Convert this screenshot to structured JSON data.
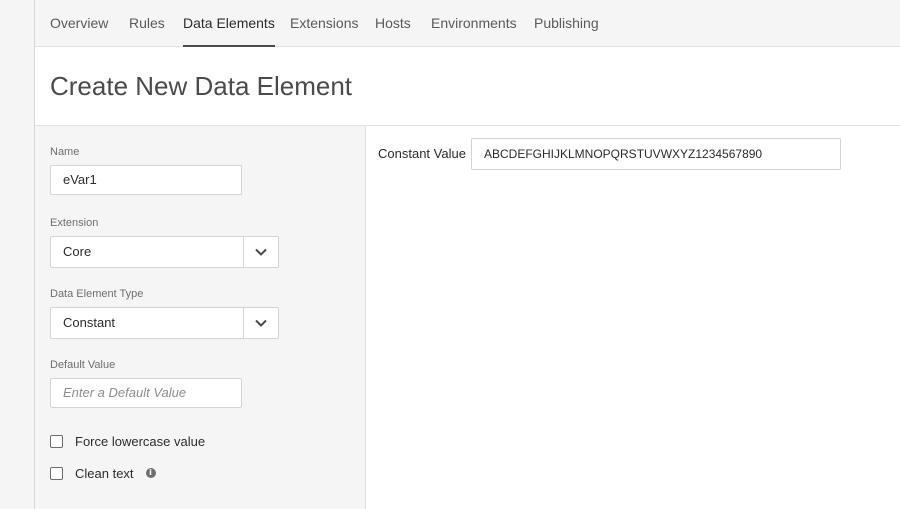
{
  "nav": {
    "tabs": [
      {
        "label": "Overview"
      },
      {
        "label": "Rules"
      },
      {
        "label": "Data Elements",
        "active": true
      },
      {
        "label": "Extensions"
      },
      {
        "label": "Hosts"
      },
      {
        "label": "Environments"
      },
      {
        "label": "Publishing"
      }
    ]
  },
  "page": {
    "title": "Create New Data Element"
  },
  "form": {
    "name_label": "Name",
    "name_value": "eVar1",
    "extension_label": "Extension",
    "extension_value": "Core",
    "type_label": "Data Element Type",
    "type_value": "Constant",
    "default_label": "Default Value",
    "default_placeholder": "Enter a Default Value",
    "force_lowercase_label": "Force lowercase value",
    "clean_text_label": "Clean text",
    "info_icon": "info-icon"
  },
  "settings": {
    "constant_label": "Constant Value",
    "constant_value": "ABCDEFGHIJKLMNOPQRSTUVWXYZ1234567890"
  },
  "icons": {
    "dropdown": "chevron-down-icon",
    "info": "info-icon"
  }
}
